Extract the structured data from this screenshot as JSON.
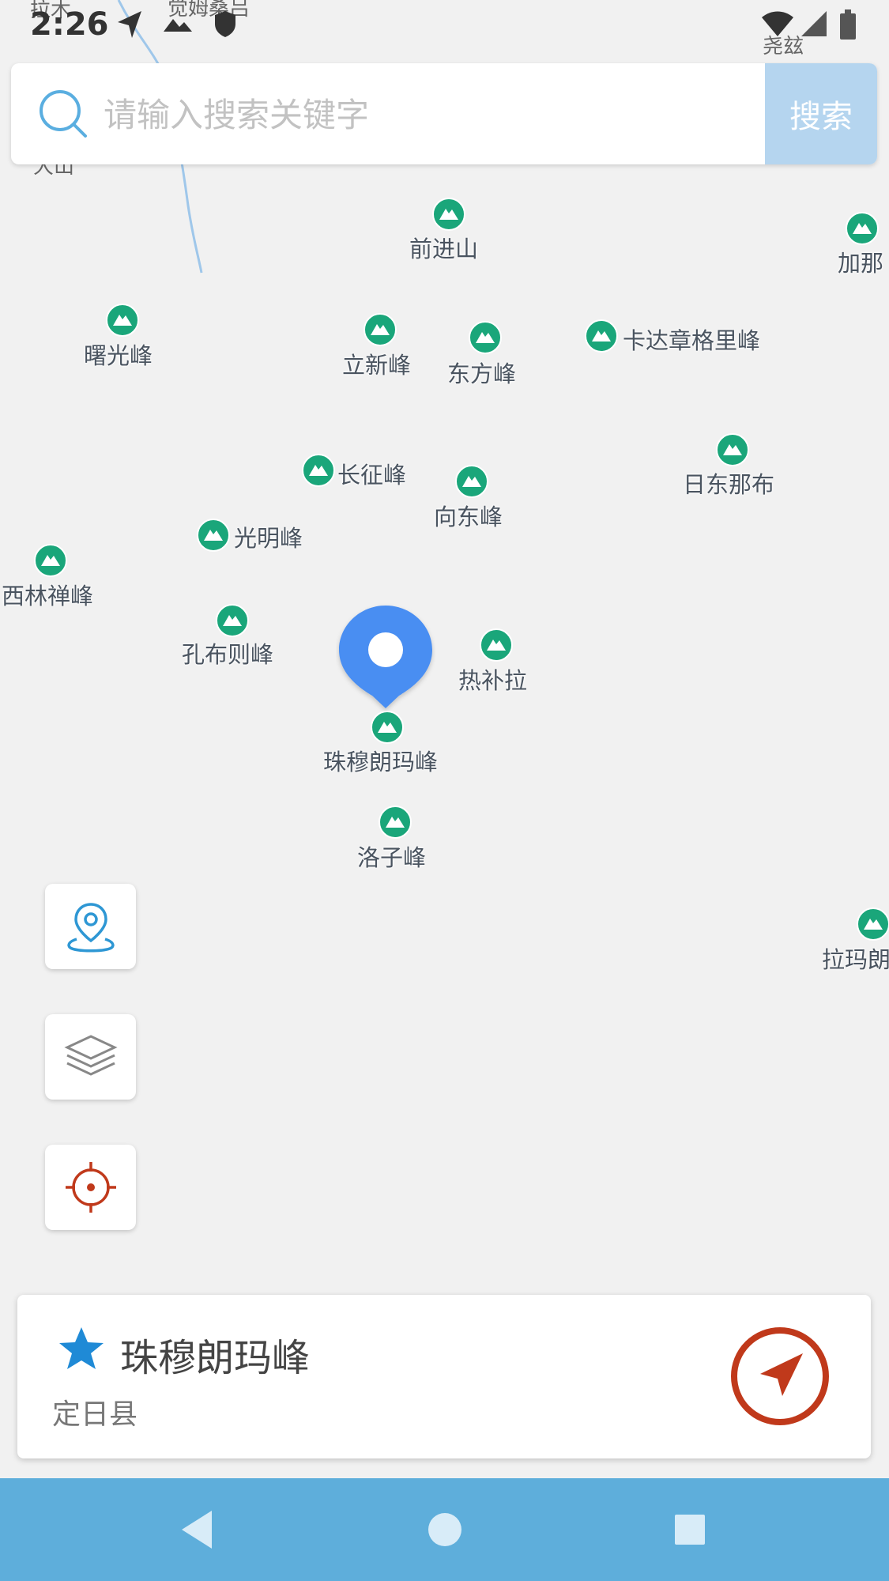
{
  "status_bar": {
    "time": "2:26",
    "icons": [
      "navigation-icon",
      "mountain-icon",
      "shield-icon",
      "wifi-icon",
      "signal-icon",
      "battery-icon"
    ]
  },
  "map_faint_labels": [
    "拉木",
    "觉姆桑吕",
    "尧玆",
    "大山"
  ],
  "search": {
    "placeholder": "请输入搜索关键字",
    "value": "",
    "button_label": "搜索"
  },
  "map": {
    "peaks": [
      {
        "name": "前进山"
      },
      {
        "name": "加那"
      },
      {
        "name": "曙光峰"
      },
      {
        "name": "立新峰"
      },
      {
        "name": "东方峰"
      },
      {
        "name": "卡达章格里峰"
      },
      {
        "name": "日东那布"
      },
      {
        "name": "长征峰"
      },
      {
        "name": "向东峰"
      },
      {
        "name": "光明峰"
      },
      {
        "name": "西林禅峰"
      },
      {
        "name": "孔布则峰"
      },
      {
        "name": "热补拉"
      },
      {
        "name": "珠穆朗玛峰"
      },
      {
        "name": "洛子峰"
      },
      {
        "name": "拉玛朗"
      }
    ],
    "marker": "location-pin-icon"
  },
  "side_buttons": [
    "location-pin-button",
    "layers-button",
    "locate-me-button"
  ],
  "info_card": {
    "name": "珠穆朗玛峰",
    "region": "定日县",
    "favorite_icon": "star-icon",
    "navigate_icon": "navigate-arrow-icon"
  },
  "nav_bar": [
    "back-button",
    "home-button",
    "recents-button"
  ],
  "colors": {
    "peak_green": "#1aa67a",
    "marker_blue": "#4a8ef2",
    "nav_bar": "#5eaedb",
    "search_button": "#b5d5ef",
    "navigate_red": "#c0391b",
    "star_blue": "#1f8ad6"
  }
}
